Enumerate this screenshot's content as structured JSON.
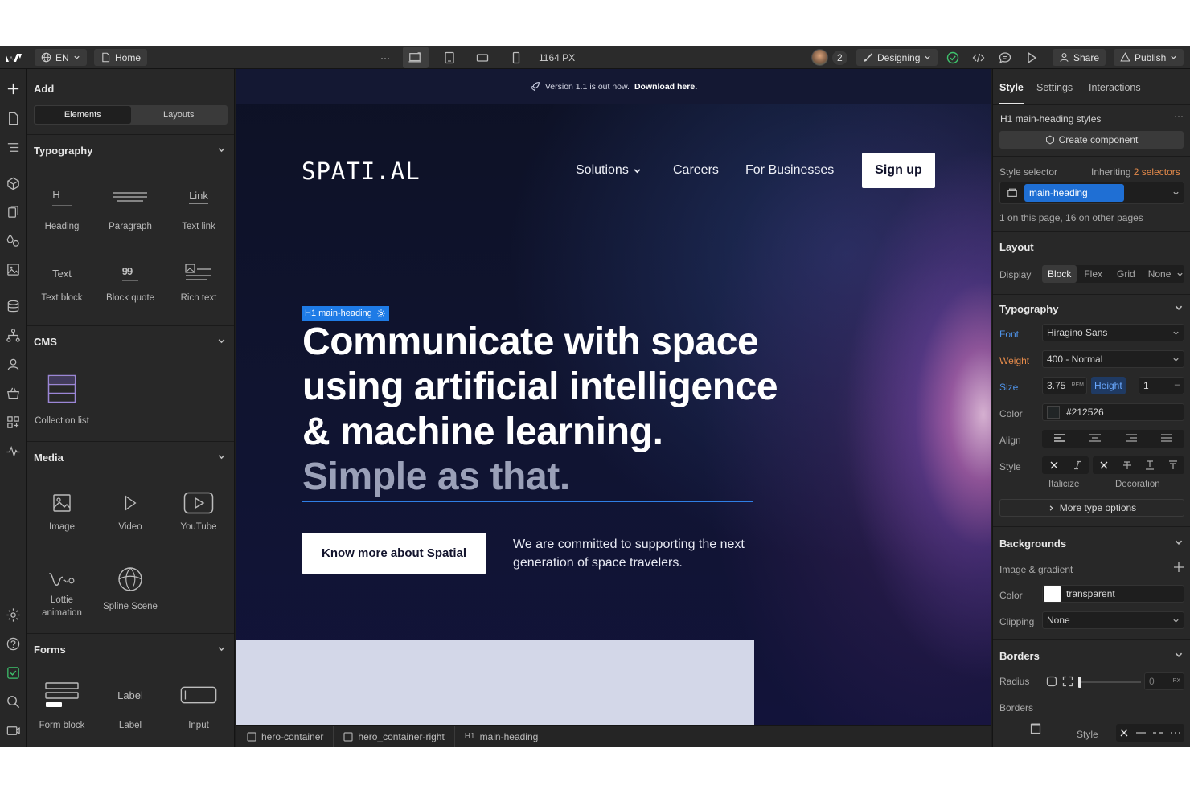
{
  "topbar": {
    "language": "EN",
    "page": "Home",
    "more": "···",
    "width_readout": "1164 PX",
    "collaborators": "2",
    "mode": "Designing",
    "share": "Share",
    "publish": "Publish"
  },
  "add_panel": {
    "title": "Add",
    "tabs": [
      "Elements",
      "Layouts"
    ],
    "sections": {
      "typography": "Typography",
      "cms": "CMS",
      "media": "Media",
      "forms": "Forms"
    },
    "typography_items": {
      "heading": {
        "label": "Heading",
        "glyph": "H"
      },
      "paragraph": {
        "label": "Paragraph"
      },
      "text_link": {
        "label": "Text link",
        "glyph": "Link"
      },
      "text_block": {
        "label": "Text block",
        "glyph": "Text"
      },
      "block_quote": {
        "label": "Block quote",
        "glyph": "99"
      },
      "rich_text": {
        "label": "Rich text"
      }
    },
    "cms_items": {
      "collection_list": "Collection list"
    },
    "media_items": {
      "image": "Image",
      "video": "Video",
      "youtube": "YouTube",
      "lottie_line1": "Lottie",
      "lottie_line2": "animation",
      "spline": "Spline Scene"
    },
    "forms_items": {
      "form_block": "Form block",
      "label": {
        "label": "Label",
        "glyph": "Label"
      },
      "input": "Input"
    }
  },
  "canvas": {
    "banner_text": "Version 1.1 is out now.",
    "banner_link": "Download here.",
    "brand": "SPATI.AL",
    "nav": {
      "solutions": "Solutions",
      "careers": "Careers",
      "businesses": "For Businesses"
    },
    "signup": "Sign up",
    "selection_tag": "H1  main-heading",
    "heading_main": "Communicate with space using artificial intelligence & machine learning.",
    "heading_muted": "Simple as that.",
    "cta": "Know more about Spatial",
    "tagline": "We are committed to supporting the next generation of space travelers."
  },
  "breadcrumbs": {
    "hero_container": "hero-container",
    "hero_container_right": "hero_container-right",
    "h1_tag": "H1",
    "main_heading": "main-heading"
  },
  "style_panel": {
    "tabs": [
      "Style",
      "Settings",
      "Interactions"
    ],
    "element_title": "H1  main-heading styles",
    "create_component": "Create component",
    "style_selector": "Style selector",
    "inheriting_prefix": "Inheriting",
    "inheriting_count": "2 selectors",
    "selector_chip": "main-heading",
    "usage_note": "1 on this page, 16 on other pages",
    "layout": {
      "title": "Layout",
      "display_label": "Display",
      "options": [
        "Block",
        "Flex",
        "Grid",
        "None"
      ]
    },
    "typography": {
      "title": "Typography",
      "font_label": "Font",
      "font_value": "Hiragino Sans",
      "weight_label": "Weight",
      "weight_value": "400 - Normal",
      "size_label": "Size",
      "size_value": "3.75",
      "size_unit": "REM",
      "height_label": "Height",
      "height_value": "1",
      "height_unit": "–",
      "color_label": "Color",
      "color_value": "#212526",
      "align_label": "Align",
      "style_label": "Style",
      "italicize": "Italicize",
      "decoration": "Decoration",
      "more_options": "More type options"
    },
    "backgrounds": {
      "title": "Backgrounds",
      "image_gradient": "Image & gradient",
      "color_label": "Color",
      "color_value": "transparent",
      "clipping_label": "Clipping",
      "clipping_value": "None"
    },
    "borders": {
      "title": "Borders",
      "radius_label": "Radius",
      "radius_value": "0",
      "radius_unit": "PX",
      "borders_label": "Borders",
      "style_label": "Style"
    }
  },
  "colors": {
    "selection_blue": "#1e7be6",
    "accent_blue": "#1f6fd4",
    "label_orange": "#e48a4a",
    "canvas_dark": "#0d1125",
    "hero_block": "#d3d7e8"
  }
}
